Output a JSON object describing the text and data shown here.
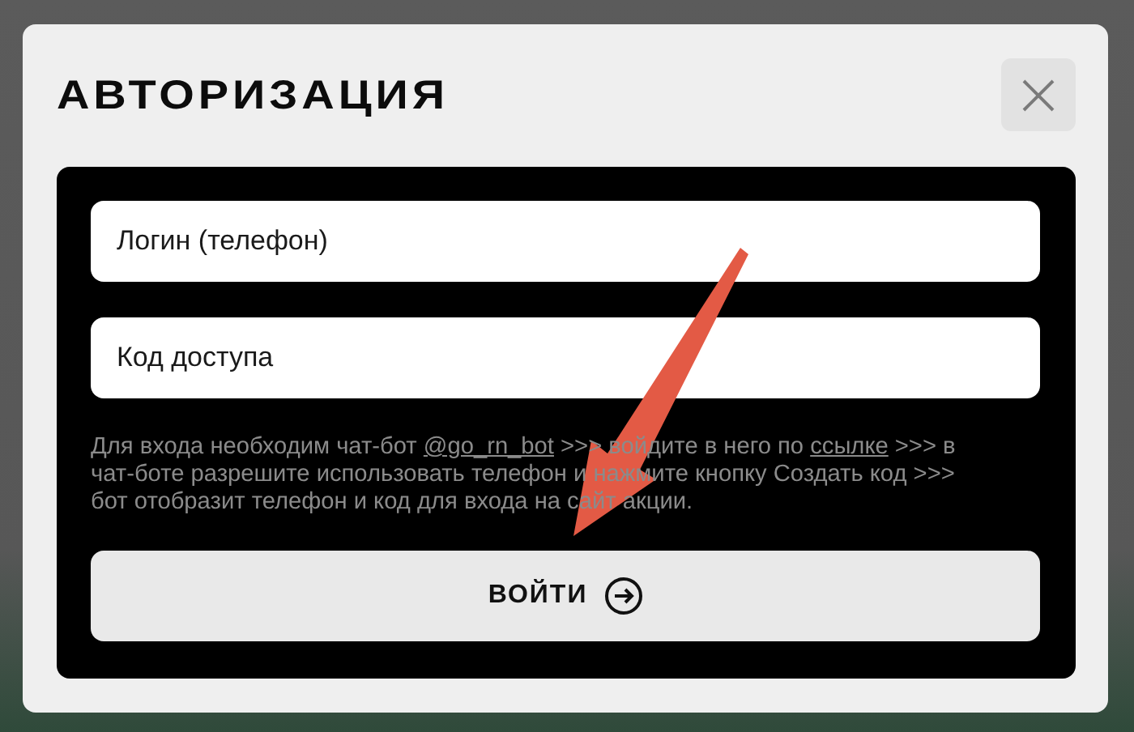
{
  "dialog": {
    "title": "АВТОРИЗАЦИЯ",
    "fields": [
      {
        "placeholder": "Логин (телефон)"
      },
      {
        "placeholder": "Код доступа"
      }
    ],
    "help_text": [
      {
        "kind": "text",
        "text": "Для входа необходим чат-бот "
      },
      {
        "kind": "link",
        "text": "@go_rn_bot"
      },
      {
        "kind": "text",
        "text": " >>> войдите в него по "
      },
      {
        "kind": "link",
        "text": "ссылке"
      },
      {
        "kind": "text",
        "text": " >>> в чат-боте разрешите использовать телефон и нажмите кнопку Создать код >>> бот отобразит телефон и код для входа на сайт акции."
      }
    ],
    "submit_button": "ВОЙТИ"
  }
}
